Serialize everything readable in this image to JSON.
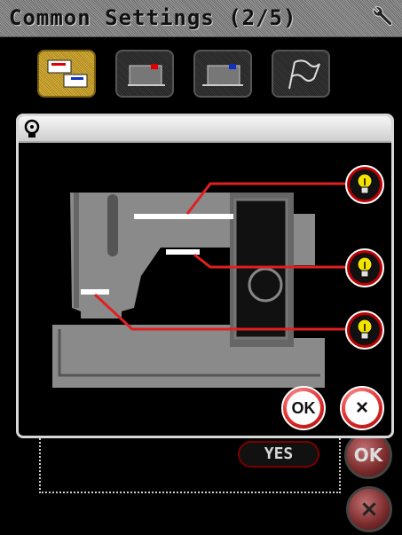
{
  "titlebar": {
    "title": "Common Settings (2/5)",
    "icon": "wrench-icon"
  },
  "toolbar": {
    "tabs": [
      {
        "name": "tab-thread-settings",
        "active": true
      },
      {
        "name": "tab-machine-red",
        "active": false
      },
      {
        "name": "tab-machine-blue",
        "active": false
      },
      {
        "name": "tab-flag",
        "active": false
      }
    ]
  },
  "background_dialog": {
    "yes_label": "YES",
    "ok_label": "OK",
    "cancel_label": "×"
  },
  "light_dialog": {
    "header_icon": "lightbulb-icon",
    "lights": [
      {
        "name": "top-light",
        "icon": "lightbulb-icon"
      },
      {
        "name": "middle-light",
        "icon": "lightbulb-icon"
      },
      {
        "name": "bottom-light",
        "icon": "lightbulb-icon"
      }
    ],
    "ok_label": "OK",
    "cancel_label": "×"
  },
  "colors": {
    "accent_red": "#e02020",
    "active_tab": "#c9a331",
    "bulb_yellow": "#f4e300"
  }
}
